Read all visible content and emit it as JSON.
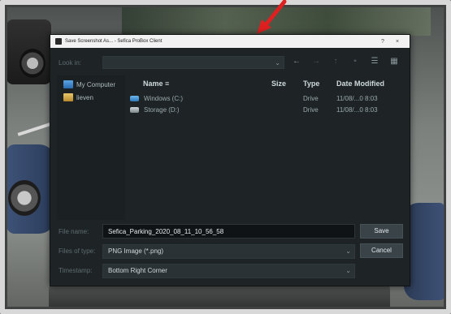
{
  "dialog": {
    "title": "Save Screenshot As... - Sefica ProBox Client",
    "help_label": "?",
    "close_label": "×"
  },
  "lookin": {
    "label": "Look in:",
    "value": ""
  },
  "nav": {
    "back": "←",
    "forward": "→",
    "up": "↑",
    "list_view": "☰",
    "detail_view": "▦"
  },
  "sidebar": {
    "items": [
      {
        "label": "My Computer",
        "icon": "computer-icon"
      },
      {
        "label": "lieven",
        "icon": "user-folder-icon"
      }
    ]
  },
  "filelist": {
    "columns": {
      "name": "Name",
      "size": "Size",
      "type": "Type",
      "date": "Date Modified"
    },
    "rows": [
      {
        "name": "Windows  (C:)",
        "size": "",
        "type": "Drive",
        "date": "11/08/...0 8:03"
      },
      {
        "name": "Storage (D:)",
        "size": "",
        "type": "Drive",
        "date": "11/08/...0 8:03"
      }
    ]
  },
  "filename": {
    "label": "File name:",
    "value": "Sefica_Parking_2020_08_11_10_56_58"
  },
  "filetype": {
    "label": "Files of type:",
    "value": "PNG Image (*.png)"
  },
  "timestamp": {
    "label": "Timestamp:",
    "value": "Bottom Right Corner"
  },
  "buttons": {
    "save": "Save",
    "cancel": "Cancel"
  },
  "colors": {
    "dialog_bg": "#1e2426",
    "input_bg": "#0f1315",
    "button_bg": "#3a4448",
    "accent_arrow": "#e02020"
  }
}
